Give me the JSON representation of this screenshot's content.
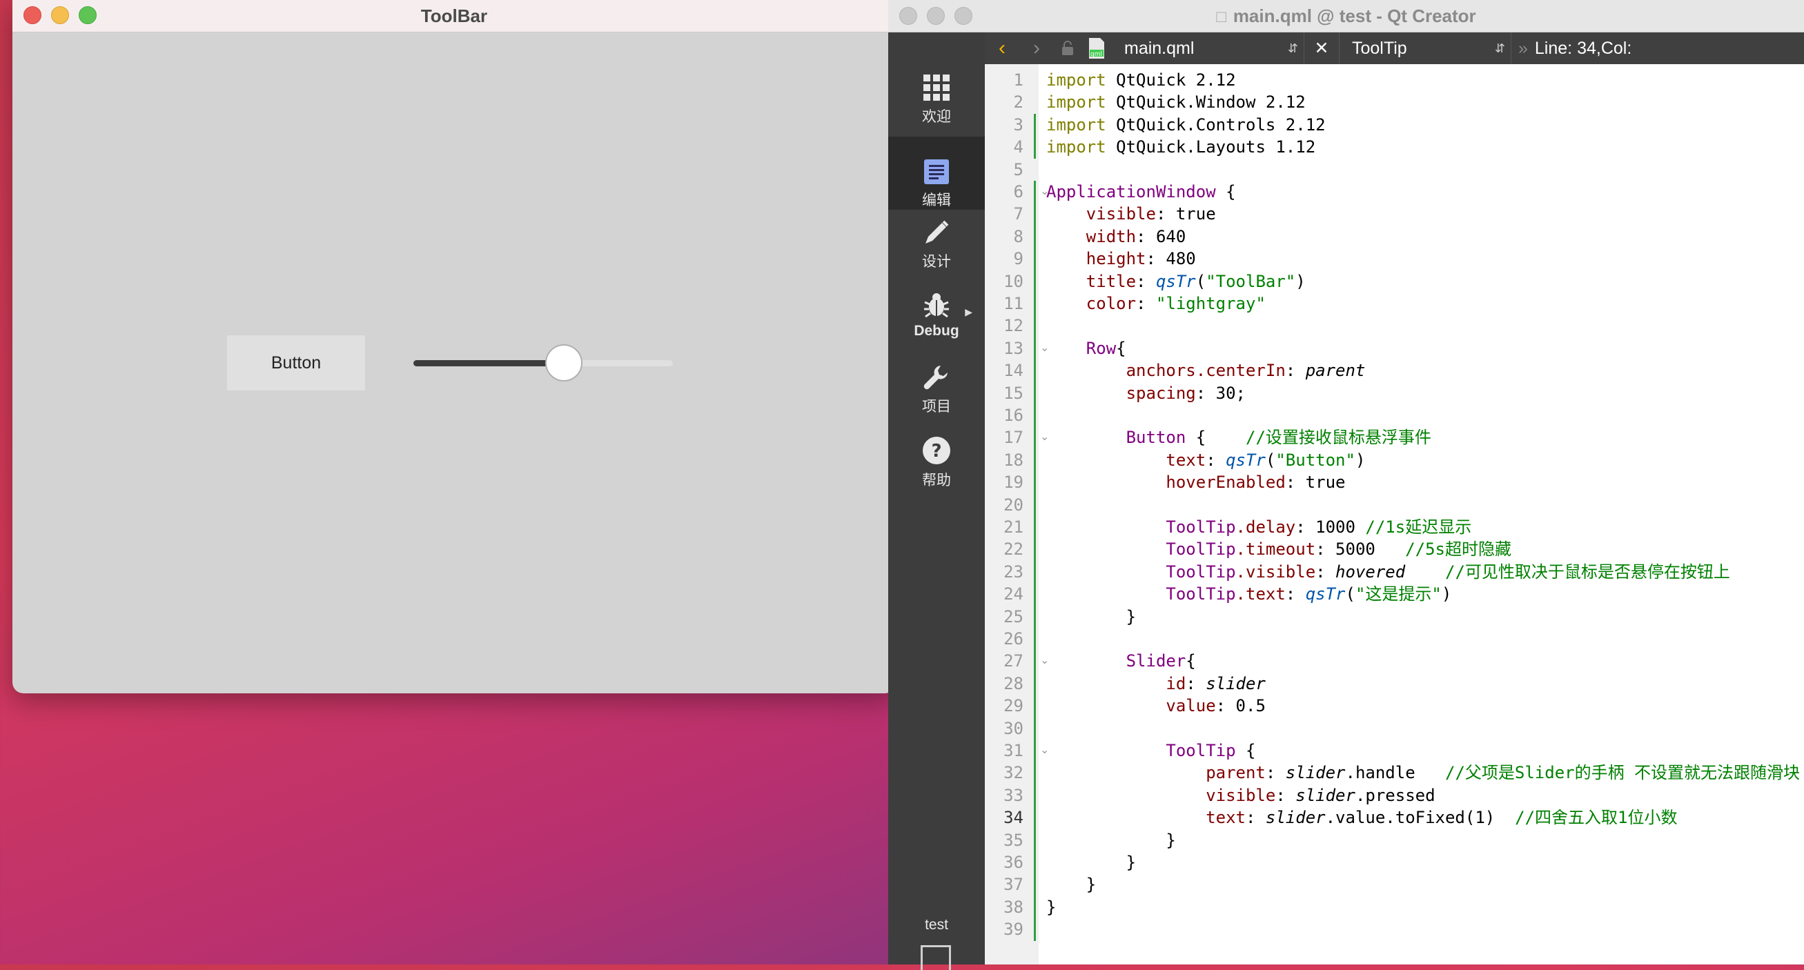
{
  "app_window": {
    "title": "ToolBar",
    "button_label": "Button",
    "slider_value": 0.58
  },
  "qt_window": {
    "title": "main.qml @ test - Qt Creator",
    "toolbar": {
      "file_name": "main.qml",
      "symbol": "ToolTip",
      "cursor": "Line: 34,Col:"
    },
    "modes": [
      {
        "label": "欢迎",
        "icon": "grid-icon"
      },
      {
        "label": "编辑",
        "icon": "document-icon"
      },
      {
        "label": "设计",
        "icon": "pencil-icon"
      },
      {
        "label": "Debug",
        "icon": "bug-icon"
      },
      {
        "label": "项目",
        "icon": "wrench-icon"
      },
      {
        "label": "帮助",
        "icon": "help-icon"
      }
    ],
    "project_label": "test",
    "current_line": 34,
    "code_lines": [
      "import QtQuick 2.12",
      "import QtQuick.Window 2.12",
      "import QtQuick.Controls 2.12",
      "import QtQuick.Layouts 1.12",
      "",
      "ApplicationWindow {",
      "    visible: true",
      "    width: 640",
      "    height: 480",
      "    title: qsTr(\"ToolBar\")",
      "    color: \"lightgray\"",
      "",
      "    Row{",
      "        anchors.centerIn: parent",
      "        spacing: 30;",
      "",
      "        Button {    //设置接收鼠标悬浮事件",
      "            text: qsTr(\"Button\")",
      "            hoverEnabled: true",
      "",
      "            ToolTip.delay: 1000 //1s延迟显示",
      "            ToolTip.timeout: 5000   //5s超时隐藏",
      "            ToolTip.visible: hovered    //可见性取决于鼠标是否悬停在按钮上",
      "            ToolTip.text: qsTr(\"这是提示\")",
      "        }",
      "",
      "        Slider{",
      "            id: slider",
      "            value: 0.5",
      "",
      "            ToolTip {",
      "                parent: slider.handle   //父项是Slider的手柄 不设置就无法跟随滑块",
      "                visible: slider.pressed",
      "                text: slider.value.toFixed(1)  //四舍五入取1位小数",
      "            }",
      "        }",
      "    }",
      "}",
      ""
    ]
  }
}
